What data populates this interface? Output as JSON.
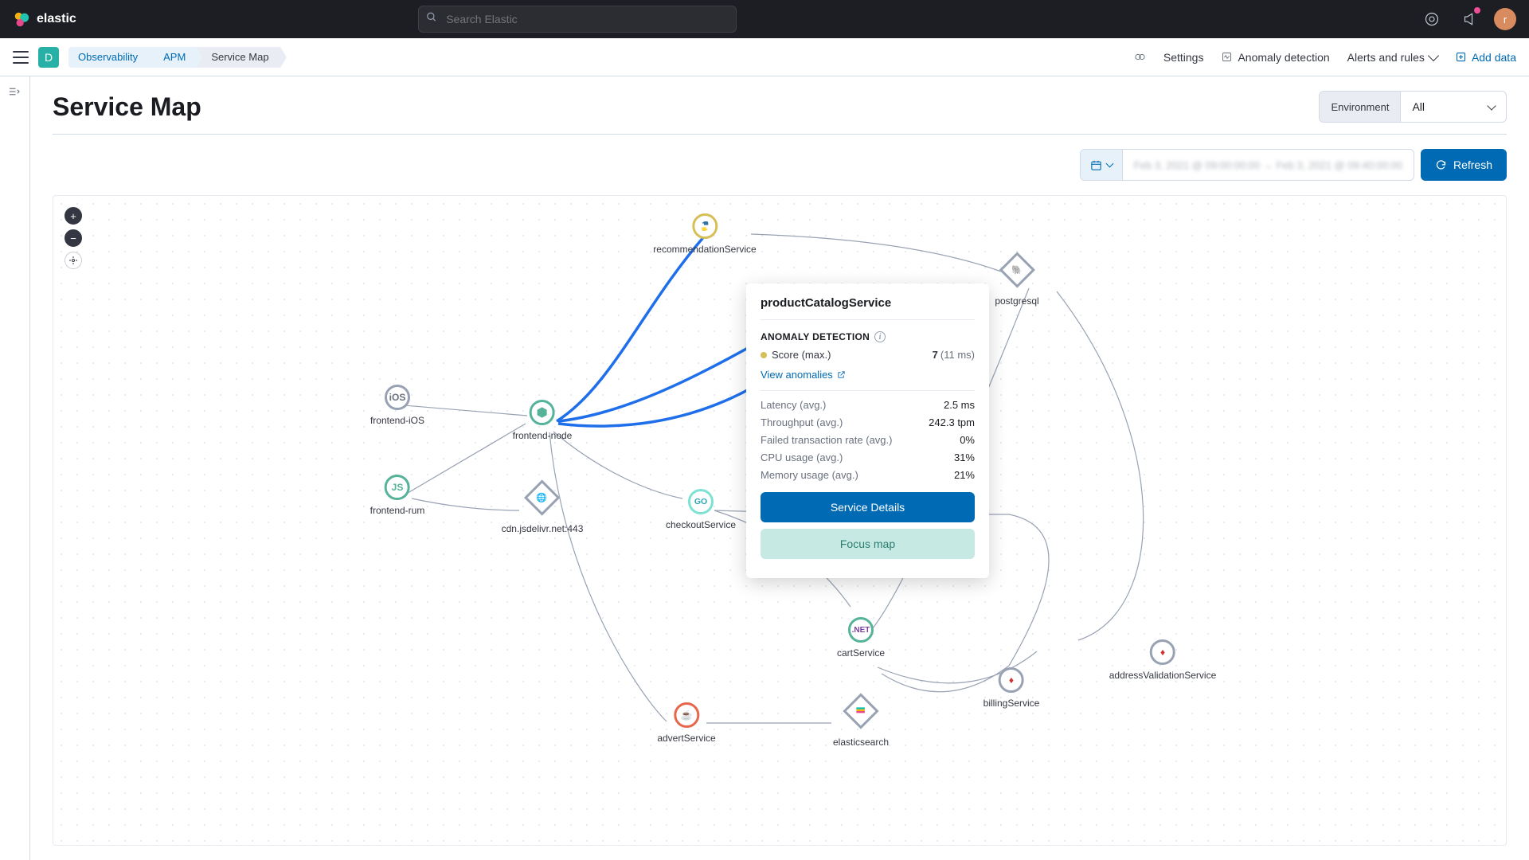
{
  "brand": "elastic",
  "search": {
    "placeholder": "Search Elastic"
  },
  "avatar_letter": "r",
  "sq_avatar_letter": "D",
  "breadcrumbs": [
    "Observability",
    "APM",
    "Service Map"
  ],
  "subnav": {
    "settings": "Settings",
    "anomaly": "Anomaly detection",
    "alerts": "Alerts and rules",
    "add_data": "Add data"
  },
  "page_title": "Service Map",
  "env": {
    "label": "Environment",
    "value": "All"
  },
  "date_range": "Feb 3, 2021 @ 09:00:00:00  →  Feb 3, 2021 @ 09:40:00:00",
  "refresh": "Refresh",
  "nodes": {
    "frontend_ios": "frontend-iOS",
    "frontend_rum": "frontend-rum",
    "frontend_node": "frontend-node",
    "cdn": "cdn.jsdelivr.net:443",
    "recommendation": "recommendationService",
    "checkout": "checkoutService",
    "postgresql": "postgresql",
    "cart": "cartService",
    "billing": "billingService",
    "address": "addressValidationService",
    "advert": "advertService",
    "elasticsearch": "elasticsearch",
    "ios_icon": "iOS",
    "js_icon": "JS",
    "go_icon": "GO",
    "net_icon": ".NET"
  },
  "popover": {
    "title": "productCatalogService",
    "section": "ANOMALY DETECTION",
    "score_label": "Score (max.)",
    "score_value": "7",
    "score_time": "(11 ms)",
    "view_anomalies": "View anomalies",
    "metrics": [
      {
        "k": "Latency (avg.)",
        "v": "2.5 ms"
      },
      {
        "k": "Throughput (avg.)",
        "v": "242.3 tpm"
      },
      {
        "k": "Failed transaction rate (avg.)",
        "v": "0%"
      },
      {
        "k": "CPU usage (avg.)",
        "v": "31%"
      },
      {
        "k": "Memory usage (avg.)",
        "v": "21%"
      }
    ],
    "service_details": "Service Details",
    "focus_map": "Focus map"
  }
}
